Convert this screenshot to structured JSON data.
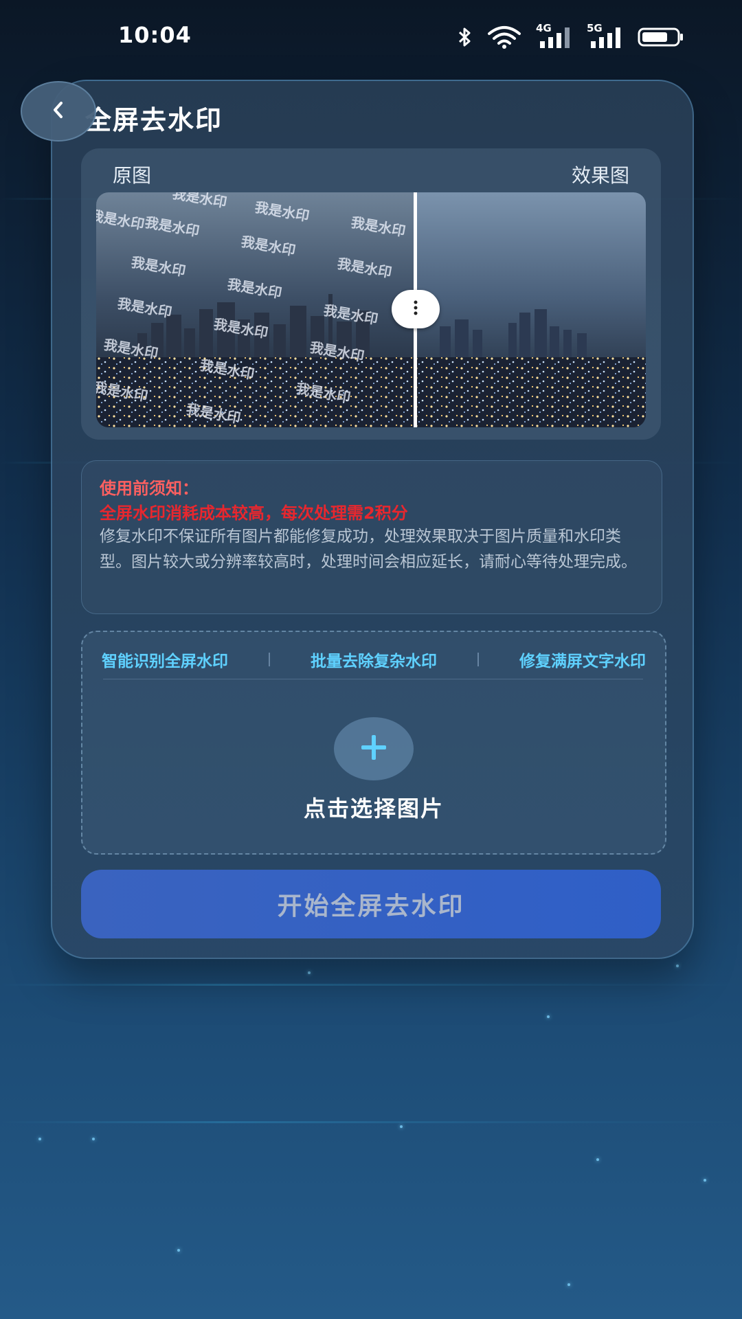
{
  "status_bar": {
    "time": "10:04",
    "network_1": "4G",
    "network_2": "5G",
    "icons": [
      "bluetooth-icon",
      "wifi-icon",
      "signal-4g-icon",
      "signal-5g-icon",
      "battery-icon"
    ]
  },
  "header": {
    "title": "全屏去水印",
    "back_icon": "chevron-left-icon"
  },
  "compare": {
    "original_label": "原图",
    "result_label": "效果图",
    "watermark_text": "我是水印"
  },
  "notice": {
    "title": "使用前须知：",
    "cost": "全屏水印消耗成本较高，每次处理需2积分",
    "body": "修复水印不保证所有图片都能修复成功，处理效果取决于图片质量和水印类型。图片较大或分辨率较高时，处理时间会相应延长，请耐心等待处理完成。"
  },
  "upload": {
    "features": [
      "智能识别全屏水印",
      "批量去除复杂水印",
      "修复满屏文字水印"
    ],
    "label": "点击选择图片",
    "icon": "plus-icon"
  },
  "actions": {
    "start": "开始全屏去水印"
  },
  "colors": {
    "accent": "#5fd1ff",
    "warning": "#e8272e",
    "button": "#3a63bf"
  }
}
